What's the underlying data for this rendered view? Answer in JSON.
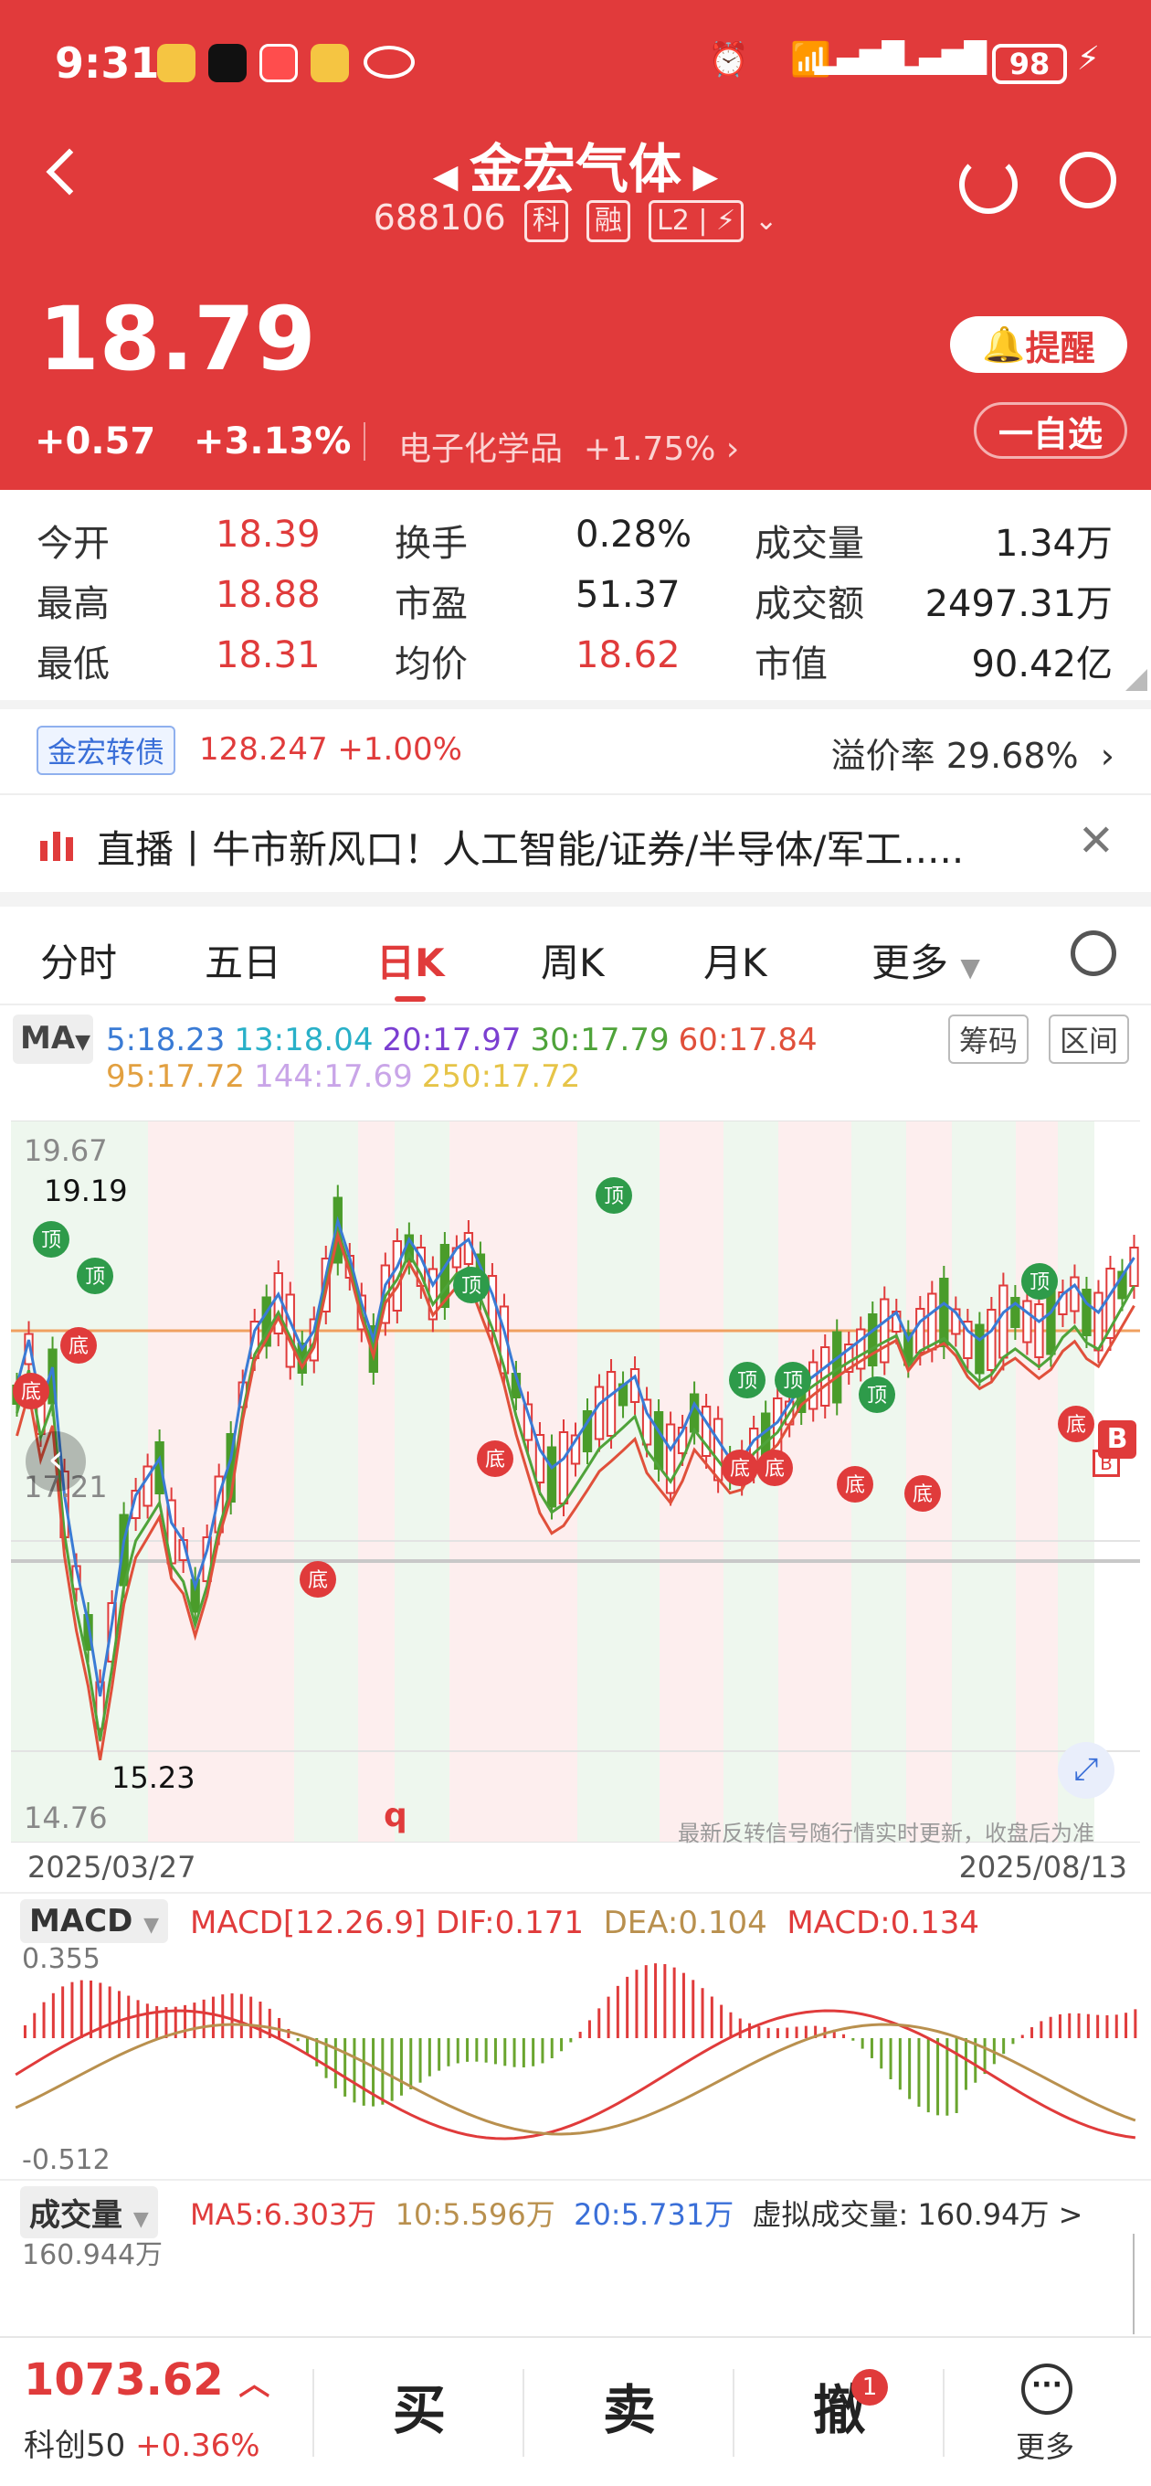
{
  "status_bar": {
    "time": "9:31",
    "battery": "98"
  },
  "header": {
    "title": "金宏气体",
    "code": "688106",
    "tag_ke": "科",
    "tag_rong": "融",
    "tag_l2": "L2",
    "price": "18.79",
    "change": "+0.57",
    "change_pct": "+3.13%",
    "sector_name": "电子化学品",
    "sector_pct": "+1.75%",
    "remind_label": "提醒",
    "watch_label": "一自选"
  },
  "stats": {
    "open_label": "今开",
    "open": "18.39",
    "high_label": "最高",
    "high": "18.88",
    "low_label": "最低",
    "low": "18.31",
    "turnover_label": "换手",
    "turnover": "0.28%",
    "pe_label": "市盈",
    "pe": "51.37",
    "avg_label": "均价",
    "avg": "18.62",
    "vol_label": "成交量",
    "vol": "1.34万",
    "amount_label": "成交额",
    "amount": "2497.31万",
    "cap_label": "市值",
    "cap": "90.42亿"
  },
  "bond": {
    "tag": "金宏转债",
    "quote": "128.247 +1.00%",
    "premium_label": "溢价率",
    "premium": "29.68%"
  },
  "banner": {
    "text": "直播丨牛市新风口！人工智能/证券/半导体/军工....."
  },
  "tabs": [
    "分时",
    "五日",
    "日K",
    "周K",
    "月K",
    "更多"
  ],
  "active_tab": 2,
  "ma": {
    "selector": "MA",
    "values": [
      {
        "text": "5:18.23",
        "color": "#3a7bd5"
      },
      {
        "text": "13:18.04",
        "color": "#29b0c8"
      },
      {
        "text": "20:17.97",
        "color": "#7b3fd1"
      },
      {
        "text": "30:17.79",
        "color": "#4fa33a"
      },
      {
        "text": "60:17.84",
        "color": "#e0503b"
      },
      {
        "text": "95:17.72",
        "color": "#e2a040"
      },
      {
        "text": "144:17.69",
        "color": "#c9a5e8"
      },
      {
        "text": "250:17.72",
        "color": "#e6c448"
      }
    ],
    "chip_btn": "筹码",
    "range_btn": "区间"
  },
  "kchart": {
    "y_top": "19.67",
    "y_mid": "17.21",
    "y_bottom": "14.76",
    "high_mark": "19.19",
    "low_mark": "15.23",
    "date_start": "2025/03/27",
    "date_end": "2025/08/13",
    "note": "最新反转信号随行情实时更新，收盘后为准",
    "top_label": "顶",
    "bottom_label": "底",
    "q_mark": "q"
  },
  "macd": {
    "selector": "MACD",
    "params": "MACD[12.26.9]",
    "dif": "DIF:0.171",
    "dea": "DEA:0.104",
    "macd_val": "MACD:0.134",
    "y_top": "0.355",
    "y_bottom": "-0.512"
  },
  "volume": {
    "selector": "成交量",
    "ma5": "MA5:6.303万",
    "ma10": "10:5.596万",
    "ma20": "20:5.731万",
    "virtual": "虚拟成交量: 160.94万 >",
    "y_top": "160.944万"
  },
  "bottom": {
    "index_value": "1073.62",
    "index_name": "科创50",
    "index_pct": "+0.36%",
    "buy": "买",
    "sell": "卖",
    "cancel": "撤",
    "cancel_badge": "1",
    "more": "更多"
  }
}
